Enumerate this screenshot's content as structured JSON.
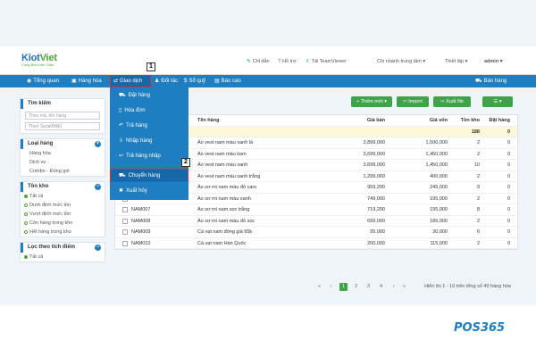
{
  "logo": {
    "primary": "Kiot",
    "accent": "Viet",
    "tagline": "Cung Bán Liên Giấu"
  },
  "top": {
    "help": "Chỉ dẫn",
    "support": "Hỗ trợ",
    "teamviewer": "Tải TeamViewer",
    "branch": "Chi nhánh trung tâm",
    "settings": "Thiết lập",
    "user": "admin"
  },
  "nav": {
    "overview": "Tổng quan",
    "goods": "Hàng hóa",
    "transactions": "Giao dịch",
    "partners": "Đối tác",
    "cashbook": "Sổ quỹ",
    "reports": "Báo cáo",
    "sell": "Bán hàng"
  },
  "badges": {
    "step1": "1",
    "step2": "2"
  },
  "dropdown": {
    "items": [
      {
        "label": "Đặt hàng"
      },
      {
        "label": "Hóa đơn"
      },
      {
        "label": "Trả hàng"
      },
      {
        "label": "Nhập hàng"
      },
      {
        "label": "Trả hàng nhập"
      },
      {
        "label": "Chuyển hàng"
      },
      {
        "label": "Xuất hủy"
      }
    ]
  },
  "sidebar": {
    "search_title": "Tìm kiếm",
    "search_placeholder": "Theo mã, tên hàng",
    "serial_placeholder": "Theo Serial/IMEI",
    "type_title": "Loại hàng",
    "types": [
      {
        "label": "Hàng hóa"
      },
      {
        "label": "Dịch vụ"
      },
      {
        "label": "Combo - Đóng gói"
      }
    ],
    "stock_title": "Tồn kho",
    "stock": [
      {
        "label": "Tất cả"
      },
      {
        "label": "Dưới định mức tồn"
      },
      {
        "label": "Vượt định mức tồn"
      },
      {
        "label": "Còn hàng trong kho"
      },
      {
        "label": "Hết hàng trong kho"
      }
    ],
    "points_title": "Lọc theo tích điểm",
    "points": [
      {
        "label": "Tất cả"
      }
    ]
  },
  "toolbar": {
    "add": "Thêm mới",
    "import": "Import",
    "export": "Xuất file"
  },
  "table": {
    "headers": {
      "name": "Tên hàng",
      "price": "Giá bán",
      "cost": "Giá vốn",
      "stock": "Tồn kho",
      "ordered": "Đặt hàng"
    },
    "summary": {
      "stock": "188",
      "ordered": "0"
    },
    "rows": [
      {
        "code": "",
        "name": "Áo vest nam màu xanh lá",
        "price": "3,899,000",
        "cost": "1,500,000",
        "stock": "2",
        "ordered": "0"
      },
      {
        "code": "",
        "name": "Áo vest nam màu kem",
        "price": "3,699,000",
        "cost": "1,450,000",
        "stock": "2",
        "ordered": "0"
      },
      {
        "code": "",
        "name": "Áo vest nam màu xanh",
        "price": "3,699,000",
        "cost": "1,450,000",
        "stock": "10",
        "ordered": "0"
      },
      {
        "code": "",
        "name": "Áo vest nam màu xanh trắng",
        "price": "1,299,000",
        "cost": "400,000",
        "stock": "2",
        "ordered": "0"
      },
      {
        "code": "NAM005",
        "name": "Áo sơ mi nam màu đỏ caro",
        "price": "959,200",
        "cost": "245,000",
        "stock": "9",
        "ordered": "0"
      },
      {
        "code": "NAM006",
        "name": "Áo sơ mi nam màu xanh",
        "price": "749,000",
        "cost": "195,000",
        "stock": "2",
        "ordered": "0"
      },
      {
        "code": "NAM007",
        "name": "Áo sơ mi nam sọc trắng",
        "price": "719,200",
        "cost": "195,000",
        "stock": "8",
        "ordered": "0"
      },
      {
        "code": "NAM008",
        "name": "Áo sơ mi nam màu đỏ sọc",
        "price": "699,000",
        "cost": "185,000",
        "stock": "2",
        "ordered": "0"
      },
      {
        "code": "NAM009",
        "name": "Cà vạt nam đồng giá 95k",
        "price": "95,000",
        "cost": "30,000",
        "stock": "6",
        "ordered": "0"
      },
      {
        "code": "NAM010",
        "name": "Cà vạt nam Hàn Quốc",
        "price": "200,000",
        "cost": "115,000",
        "stock": "2",
        "ordered": "0"
      }
    ]
  },
  "pager": {
    "pages": [
      "1",
      "2",
      "3",
      "4"
    ],
    "info": "Hiển thị 1 - 10 trên tổng số 40 hàng hóa"
  },
  "brand": "POS365",
  "colors": {
    "primary": "#1e7ec0",
    "green": "#3fa34a",
    "highlight": "#e02b2b"
  }
}
